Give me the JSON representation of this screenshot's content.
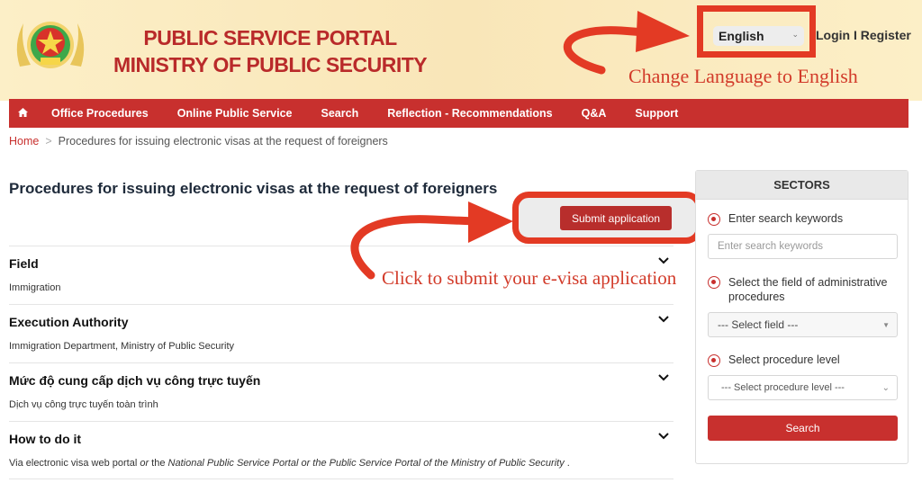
{
  "header": {
    "title_line1": "PUBLIC SERVICE PORTAL",
    "title_line2": "MINISTRY OF PUBLIC SECURITY",
    "logo_icon": "police-emblem-icon",
    "language_selected": "English",
    "login_label": "Login",
    "auth_separator": "I",
    "register_label": "Register"
  },
  "annotations": {
    "language": "Change Language to English",
    "submit": "Click to submit your e-visa application"
  },
  "nav": {
    "home_icon": "home-icon",
    "items": [
      "Office Procedures",
      "Online Public Service",
      "Search",
      "Reflection - Recommendations",
      "Q&A",
      "Support"
    ]
  },
  "breadcrumb": {
    "home": "Home",
    "separator": ">",
    "current": "Procedures for issuing electronic visas at the request of foreigners"
  },
  "main": {
    "title": "Procedures for issuing electronic visas at the request of foreigners",
    "submit_label": "Submit application",
    "sections": [
      {
        "title": "Field",
        "body": "Immigration"
      },
      {
        "title": "Execution Authority",
        "body": "Immigration Department, Ministry of Public Security"
      },
      {
        "title": "Mức độ cung cấp dịch vụ công trực tuyến",
        "body": "Dịch vụ công trực tuyến toàn trình"
      },
      {
        "title": "How to do it",
        "body_parts": [
          "Via electronic visa web portal ",
          "or",
          " the ",
          "National Public Service Portal or the Public Service Portal of the Ministry of Public Security",
          " ."
        ]
      }
    ]
  },
  "sidebar": {
    "heading": "SECTORS",
    "keyword_label": "Enter search keywords",
    "keyword_placeholder": "Enter search keywords",
    "field_label": "Select the field of administrative procedures",
    "field_select": "--- Select field ---",
    "level_label": "Select procedure level",
    "level_select": "--- Select procedure level ---",
    "search_label": "Search"
  },
  "colors": {
    "brand_red": "#c8302e",
    "annotation_red": "#e33a24",
    "header_bg": "#fcefc7"
  }
}
